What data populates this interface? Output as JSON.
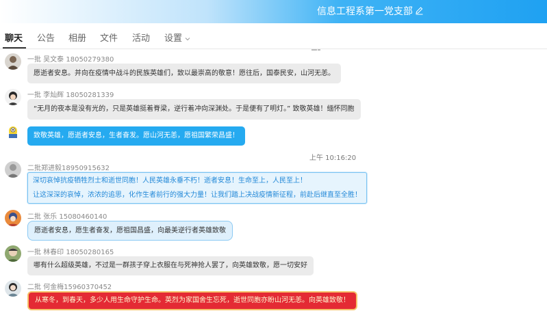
{
  "header": {
    "title": "信息工程系第一党支部"
  },
  "tabs": [
    "聊天",
    "公告",
    "相册",
    "文件",
    "活动",
    "设置"
  ],
  "messages": [
    {
      "sender": "一批 吴文泰 18050279380",
      "lines": [
        "愿逝者安息。并向在疫情中战斗的民族英雄们，致以最崇高的敬意！愿往后，国泰民安，山河无恙。"
      ]
    },
    {
      "sender": "一批 李灿辉 18050281339",
      "lines": [
        "“无月的夜本是没有光的，只是英雄挺着脊梁，逆行着冲向深渊处。于是便有了明灯。”  致敬英雄！缅怀同胞"
      ]
    },
    {
      "sender": "",
      "lines": [
        "致敬英雄，愿逝者安息，生者奋发。愿山河无恙，愿祖国繁荣昌盛！"
      ]
    },
    {
      "sender": "二批郑进毅18950915632",
      "lines": [
        "深切哀悼抗疫牺牲烈士和逝世同胞！人民英雄永垂不朽！逝者安息！生命至上，人民至上！",
        "让这深深的哀悼，浓浓的追思，化作生者前行的强大力量！让我们踏上决战疫情新征程，前赴后继直至全胜！"
      ]
    },
    {
      "sender": "二批 张乐 15080460140",
      "lines": [
        "愿逝者安息，愿生者奋发，愿祖国昌盛，向最美逆行者英雄致敬"
      ]
    },
    {
      "sender": "一批 林春印 18050280165",
      "lines": [
        "哪有什么超级英雄，不过是一群孩子穿上衣服在与死神抢人罢了，向英雄致敬，愿一切安好"
      ]
    },
    {
      "sender": "二批 何金梅15960370452",
      "lines": [
        "从寒冬，到春天，多少人用生命守护生命。英烈为家国舍生忘死，逝世同胞亦盼山河无恙。向英雄致敬！"
      ]
    }
  ],
  "timestamp": "上午 10:16:20",
  "colors": {
    "accent": "#25aaf0",
    "red_bubble": "#e42a34",
    "gray_bubble": "#ebebeb"
  }
}
